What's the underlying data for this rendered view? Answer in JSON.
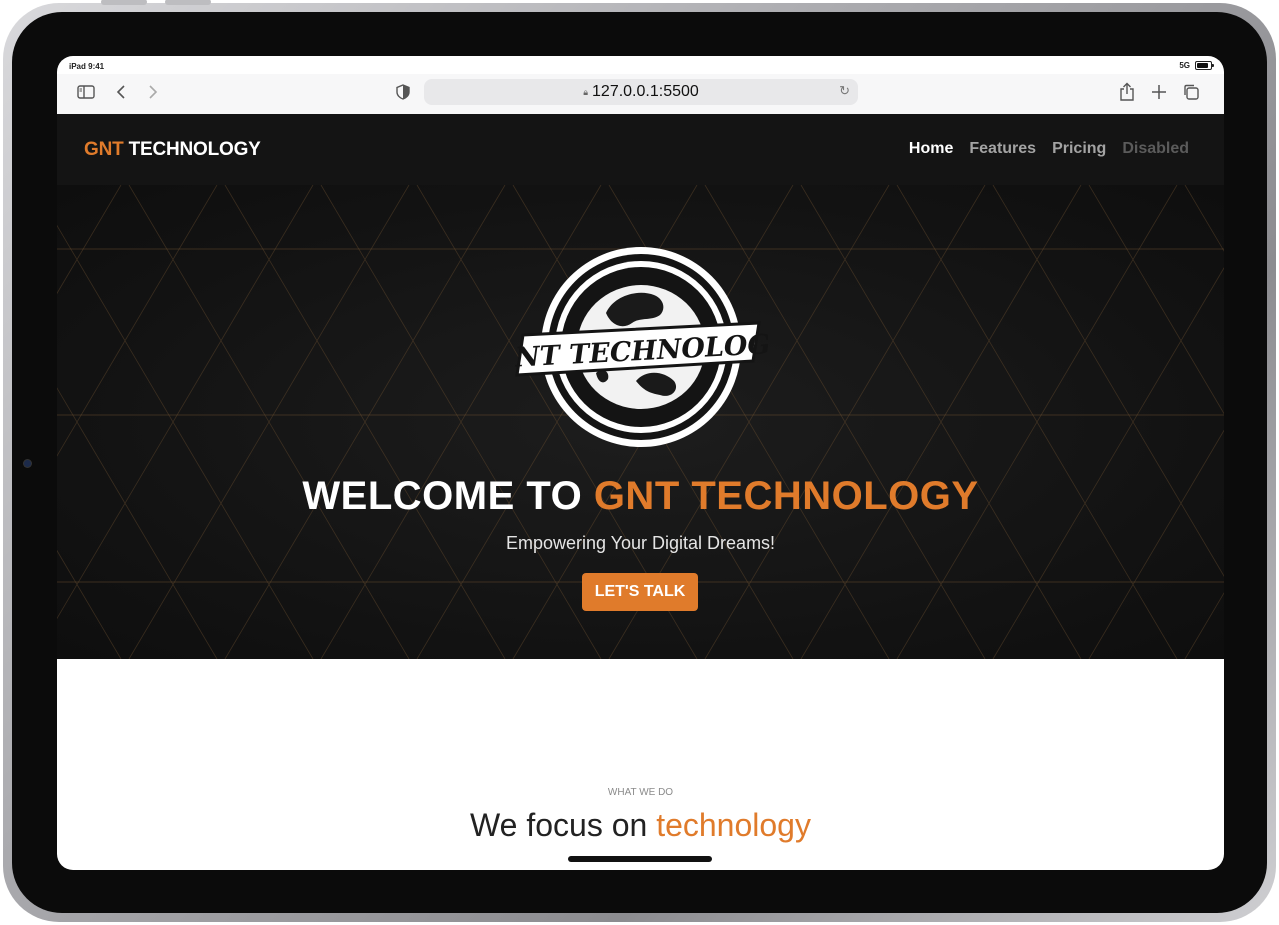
{
  "status": {
    "time": "iPad 9:41",
    "network": "5G"
  },
  "browser": {
    "url": "127.0.0.1:5500"
  },
  "site": {
    "brand": {
      "part1": "GNT",
      "part2": " TECHNOLOGY"
    },
    "nav": [
      {
        "label": "Home"
      },
      {
        "label": "Features"
      },
      {
        "label": "Pricing"
      },
      {
        "label": "Disabled"
      }
    ],
    "hero": {
      "logo_text": "GNT TECHNOLOGY",
      "title_part1": "WELCOME TO ",
      "title_part2": "GNT TECHNOLOGY",
      "subtitle": "Empowering Your Digital Dreams!",
      "cta": "LET'S TALK"
    },
    "section": {
      "kicker": "WHAT WE DO",
      "title_part1": "We focus on ",
      "title_part2": "technology"
    }
  },
  "colors": {
    "accent": "#e07b2b",
    "nav_bg": "#141414",
    "hero_bg": "#121212"
  }
}
